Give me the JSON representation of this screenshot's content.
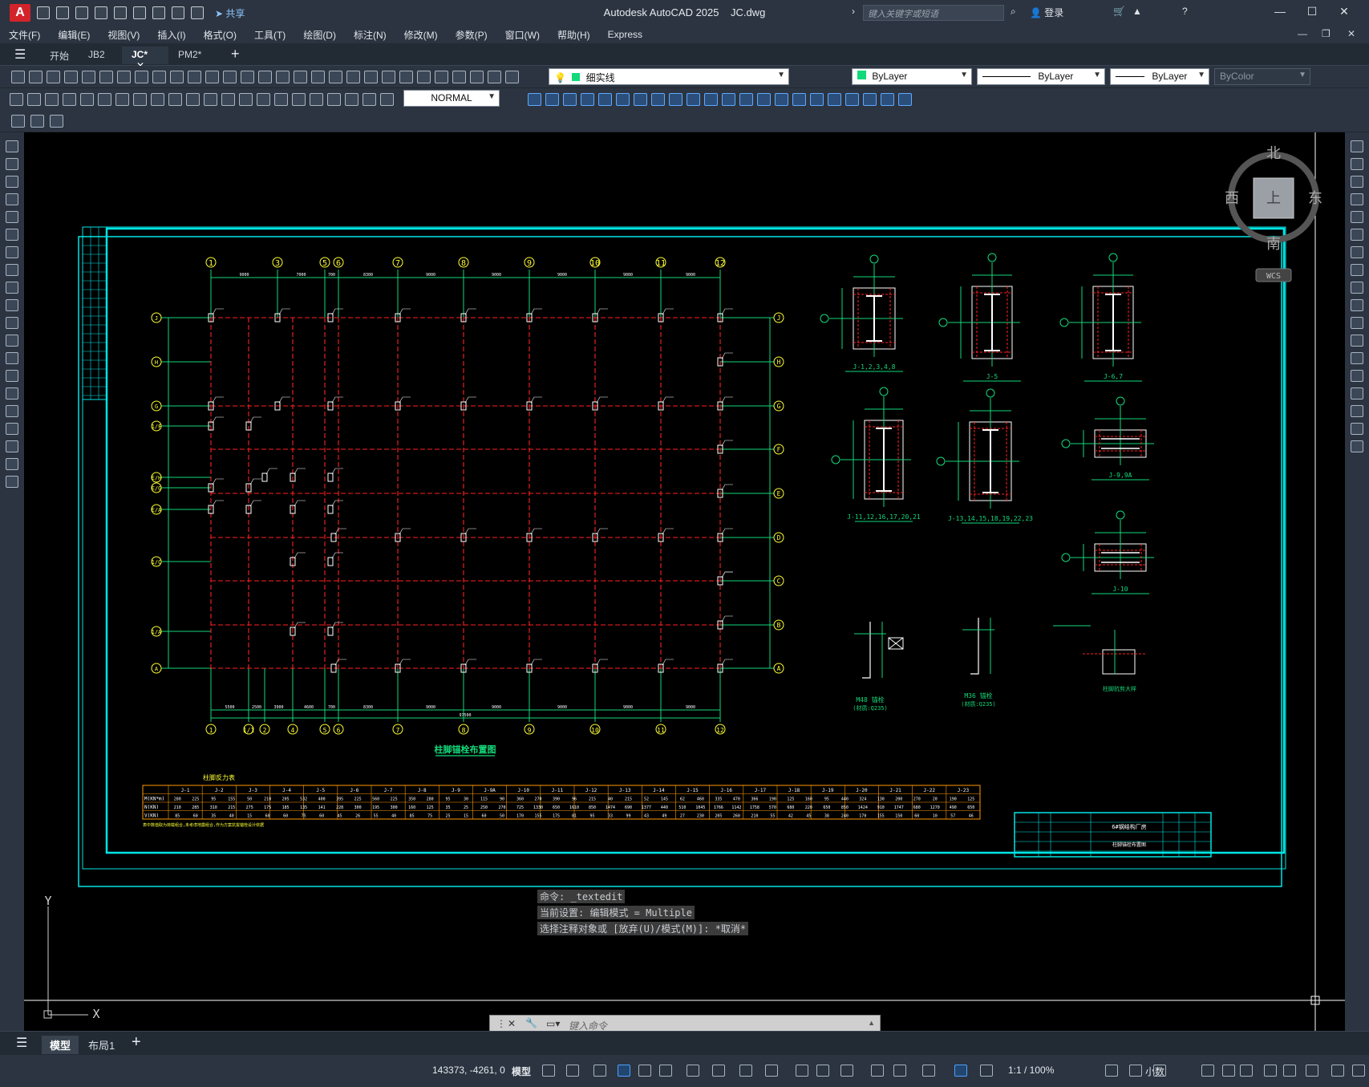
{
  "titlebar": {
    "app_title": "Autodesk AutoCAD 2025",
    "file_name": "JC.dwg",
    "share_label": "共享",
    "search_placeholder": "键入关键字或短语",
    "login_label": "登录",
    "logo_letter": "A"
  },
  "menu": [
    "文件(F)",
    "编辑(E)",
    "视图(V)",
    "插入(I)",
    "格式(O)",
    "工具(T)",
    "绘图(D)",
    "标注(N)",
    "修改(M)",
    "参数(P)",
    "窗口(W)",
    "帮助(H)",
    "Express"
  ],
  "doc_tabs": {
    "start": "开始",
    "tab1": "JB2",
    "tab2": "JC*",
    "tab3": "PM2*"
  },
  "properties": {
    "layer": "细实线",
    "color": "ByLayer",
    "linetype": "ByLayer",
    "lineweight": "ByLayer",
    "plotstyle": "ByColor",
    "text_style": "NORMAL"
  },
  "viewcube": {
    "north": "北",
    "south": "南",
    "east": "东",
    "west": "西",
    "face": "上",
    "wcs": "WCS"
  },
  "ucs": {
    "x": "X",
    "y": "Y"
  },
  "drawing": {
    "top_axes": [
      "1",
      "3",
      "5",
      "6",
      "7",
      "8",
      "9",
      "10",
      "11",
      "12"
    ],
    "bottom_axes": [
      "1",
      "1/1",
      "2",
      "4",
      "5",
      "6",
      "7",
      "8",
      "9",
      "10",
      "11",
      "12"
    ],
    "left_axes": [
      "J",
      "H",
      "G",
      "1/F",
      "E/H",
      "E/G",
      "E/A",
      "1/C",
      "1/A",
      "A"
    ],
    "right_axes": [
      "J",
      "H",
      "G",
      "F",
      "E",
      "D",
      "C",
      "B",
      "A"
    ],
    "top_dims": [
      "9000",
      "7000",
      "700",
      "8300",
      "9000",
      "9000",
      "9000",
      "9000",
      "9000"
    ],
    "bottom_dims": [
      "5500",
      "2500",
      "3900",
      "4600",
      "700",
      "8300",
      "9000",
      "9000",
      "9000",
      "9000",
      "9000"
    ],
    "bottom_total": "97500",
    "plan_title": "柱脚锚栓布置图",
    "details": [
      {
        "label": "J-1,2,3,4,8"
      },
      {
        "label": "J-5"
      },
      {
        "label": "J-6,7"
      },
      {
        "label": "J-11,12,16,17,20,21"
      },
      {
        "label": "J-13,14,15,18,19,22,23"
      },
      {
        "label": "J-9,9A"
      },
      {
        "label": "J-10"
      },
      {
        "label": "M48 锚栓"
      },
      {
        "label": "(材质:Q235)"
      },
      {
        "label": "M36 锚栓"
      },
      {
        "label": "(材质:Q235)"
      },
      {
        "label": "柱脚抗剪大样"
      }
    ],
    "reaction_table": {
      "title": "柱脚反力表",
      "columns": [
        "J-1",
        "J-2",
        "J-3",
        "J-4",
        "J-5",
        "J-6",
        "J-7",
        "J-8",
        "J-9",
        "J-9A",
        "J-10",
        "J-11",
        "J-12",
        "J-13",
        "J-14",
        "J-15",
        "J-16",
        "J-17",
        "J-18",
        "J-19",
        "J-20",
        "J-21",
        "J-22",
        "J-23"
      ],
      "rows": [
        {
          "label": "M(KN*m)",
          "values": [
            "280",
            "225",
            "95",
            "155",
            "50",
            "210",
            "205",
            "532",
            "400",
            "395",
            "225",
            "560",
            "225",
            "350",
            "280",
            "95",
            "30",
            "115",
            "90",
            "360",
            "270",
            "390",
            "96",
            "215",
            "40",
            "215",
            "52",
            "145",
            "62",
            "460",
            "335",
            "470",
            "366",
            "190",
            "125",
            "160",
            "95",
            "440",
            "324",
            "130",
            "200",
            "270",
            "20",
            "190",
            "125"
          ]
        },
        {
          "label": "N(KN)",
          "values": [
            "210",
            "285",
            "310",
            "215",
            "275",
            "175",
            "185",
            "135",
            "141",
            "228",
            "300",
            "195",
            "300",
            "160",
            "125",
            "35",
            "25",
            "250",
            "270",
            "725",
            "1330",
            "650",
            "1610",
            "850",
            "1474",
            "690",
            "1377",
            "440",
            "510",
            "1045",
            "1766",
            "1142",
            "1758",
            "570",
            "680",
            "220",
            "650",
            "850",
            "1424",
            "910",
            "1747",
            "680",
            "1270",
            "490",
            "650"
          ]
        },
        {
          "label": "V(KN)",
          "values": [
            "85",
            "60",
            "35",
            "40",
            "15",
            "60",
            "60",
            "75",
            "60",
            "45",
            "26",
            "55",
            "40",
            "85",
            "75",
            "25",
            "15",
            "60",
            "50",
            "170",
            "155",
            "175",
            "81",
            "95",
            "33",
            "99",
            "43",
            "49",
            "27",
            "230",
            "205",
            "260",
            "210",
            "55",
            "42",
            "45",
            "38",
            "240",
            "170",
            "155",
            "150",
            "60",
            "10",
            "57",
            "46"
          ]
        }
      ],
      "note": "表中数值取为荷载组合,未考虑地震组合,作为方案抗拔锚栓设计依据"
    },
    "title_block": {
      "project": "6#钢结构厂房",
      "drawing_name": "柱脚锚栓布置图"
    }
  },
  "command": {
    "history": [
      "命令: _textedit",
      "当前设置: 编辑模式 = Multiple",
      "选择注释对象或 [放弃(U)/模式(M)]: *取消*"
    ],
    "placeholder": "键入命令"
  },
  "layouts": {
    "model": "模型",
    "layout1": "布局1"
  },
  "status": {
    "coords": "143373, -4261, 0",
    "model": "模型",
    "scale": "1:1 / 100%",
    "units": "小数"
  }
}
